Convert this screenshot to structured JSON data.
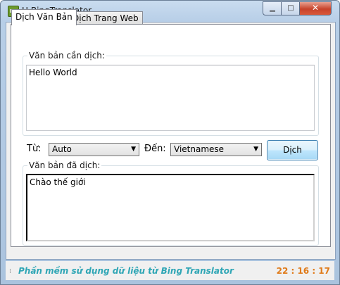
{
  "window": {
    "title": "H-BingTranslator",
    "icon_name": "app-icon",
    "icon_text": "BT",
    "minimize_glyph": "▁",
    "maximize_glyph": "□",
    "close_glyph": "✕"
  },
  "tabs": [
    {
      "label": "Dịch Văn Bản",
      "active": true
    },
    {
      "label": "Dịch Trang Web",
      "active": false
    }
  ],
  "source": {
    "group_label": "Văn bản cần dịch:",
    "text": "Hello World"
  },
  "controls": {
    "from_label": "Từ:",
    "from_value": "Auto",
    "to_label": "Đến:",
    "to_value": "Vietnamese",
    "translate_label": "Dịch",
    "dropdown_glyph": "▼"
  },
  "output": {
    "group_label": "Văn bản đã dịch:",
    "text": "Chào thế giới"
  },
  "status": {
    "text": "Phần mềm sử dụng dữ liệu từ Bing Translator",
    "clock": "22 : 16 : 17",
    "text_color": "#2fa6b5",
    "clock_color": "#e07b1a"
  }
}
